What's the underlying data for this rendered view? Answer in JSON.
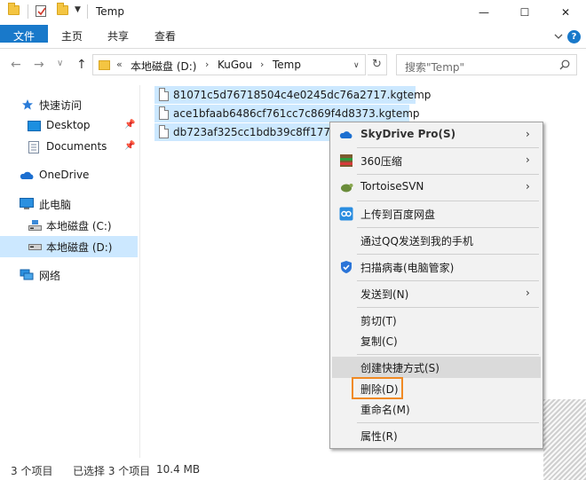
{
  "window": {
    "title": "Temp",
    "minimize": "—",
    "maximize": "☐",
    "close": "✕"
  },
  "ribbon": {
    "tabs": [
      {
        "label": "文件",
        "active": true
      },
      {
        "label": "主页"
      },
      {
        "label": "共享"
      },
      {
        "label": "查看"
      }
    ],
    "help": "?"
  },
  "navigation": {
    "back": "←",
    "forward": "→",
    "recent": "∨",
    "up": "↑"
  },
  "address": {
    "overflow": "«",
    "crumbs": [
      "本地磁盘 (D:)",
      "KuGou",
      "Temp"
    ],
    "separator": "›",
    "dropdown": "∨",
    "refresh": "↻"
  },
  "search": {
    "placeholder": "搜索\"Temp\""
  },
  "sidebar": {
    "items": [
      {
        "label": "快速访问",
        "icon": "star-icon"
      },
      {
        "label": "Desktop",
        "icon": "desktop-icon",
        "pinned": true
      },
      {
        "label": "Documents",
        "icon": "documents-icon",
        "pinned": true
      },
      {
        "label": "OneDrive",
        "icon": "onedrive-icon"
      },
      {
        "label": "此电脑",
        "icon": "computer-icon"
      },
      {
        "label": "本地磁盘 (C:)",
        "icon": "drive-icon"
      },
      {
        "label": "本地磁盘 (D:)",
        "icon": "drive-icon",
        "selected": true
      },
      {
        "label": "网络",
        "icon": "network-icon"
      }
    ]
  },
  "files": [
    {
      "name": "81071c5d76718504c4e0245dc76a2717.kgtemp"
    },
    {
      "name": "ace1bfaab6486cf761cc7c869f4d8373.kgtemp"
    },
    {
      "name": "db723af325cc1bdb39c8ff177c"
    }
  ],
  "context_menu": {
    "items": [
      {
        "label": "SkyDrive Pro(S)",
        "icon": "skydrive-icon",
        "submenu": true,
        "bold": true
      },
      {
        "label": "360压缩",
        "icon": "archive-360-icon",
        "submenu": true
      },
      {
        "label": "TortoiseSVN",
        "icon": "tortoisesvn-icon",
        "submenu": true
      },
      {
        "label": "上传到百度网盘",
        "icon": "baidu-pan-icon"
      },
      {
        "label": "通过QQ发送到我的手机"
      },
      {
        "label": "扫描病毒(电脑管家)",
        "icon": "shield-icon"
      },
      {
        "label": "发送到(N)",
        "submenu": true
      },
      {
        "label": "剪切(T)"
      },
      {
        "label": "复制(C)"
      },
      {
        "label": "创建快捷方式(S)",
        "hovered": true
      },
      {
        "label": "删除(D)",
        "highlighted": true
      },
      {
        "label": "重命名(M)"
      },
      {
        "label": "属性(R)"
      }
    ],
    "submenu_arrow": "›"
  },
  "status": {
    "count": "3 个项目",
    "selected": "已选择 3 个项目",
    "size": "10.4 MB"
  },
  "colors": {
    "accent": "#1979ca",
    "selection": "#cce8ff",
    "highlight_border": "#f08a24"
  }
}
